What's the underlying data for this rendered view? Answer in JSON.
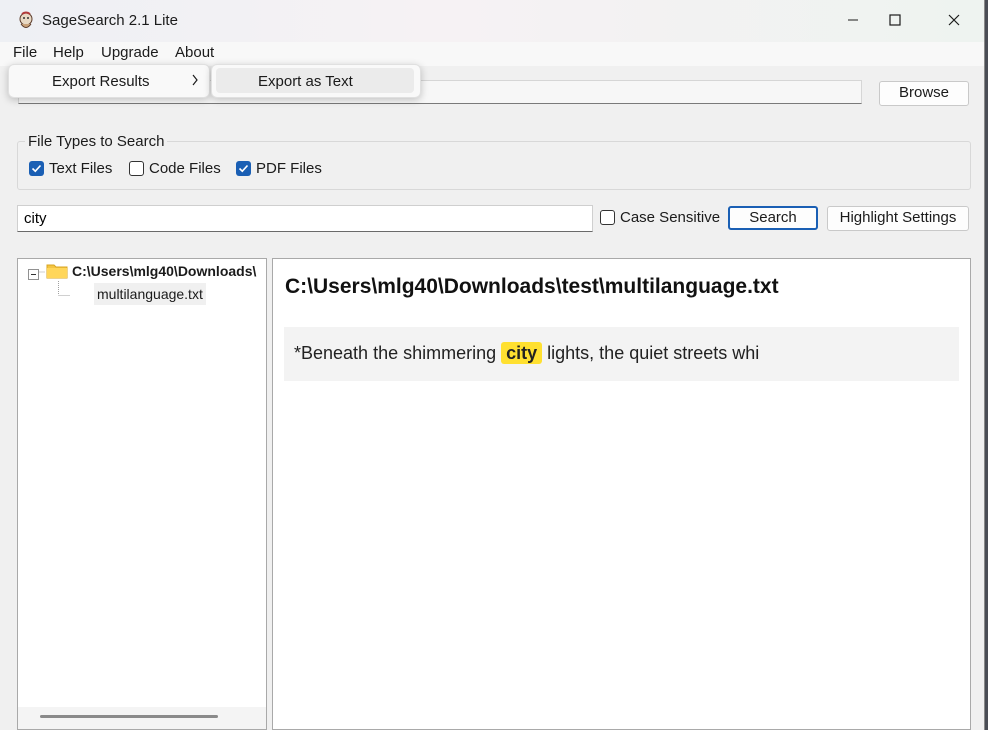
{
  "window": {
    "title": "SageSearch 2.1 Lite"
  },
  "menu": {
    "file": "File",
    "help": "Help",
    "upgrade": "Upgrade",
    "about": "About"
  },
  "dropdown": {
    "export_results": "Export Results",
    "export_as_text": "Export as Text"
  },
  "browse": {
    "label": "Browse"
  },
  "file_types": {
    "title": "File Types to Search",
    "options": [
      {
        "label": "Text Files",
        "checked": true
      },
      {
        "label": "Code Files",
        "checked": false
      },
      {
        "label": "PDF Files",
        "checked": true
      }
    ]
  },
  "search": {
    "query": "city",
    "case_sensitive_label": "Case Sensitive",
    "case_sensitive": false,
    "search_label": "Search",
    "highlight_label": "Highlight Settings"
  },
  "tree": {
    "root": "C:\\Users\\mlg40\\Downloads\\",
    "child": "multilanguage.txt"
  },
  "results": {
    "file_path": "C:\\Users\\mlg40\\Downloads\\test\\multilanguage.txt",
    "snippet_before": "*Beneath the shimmering ",
    "snippet_match": "city",
    "snippet_after": " lights, the quiet streets whi"
  },
  "colors": {
    "accent": "#1a5fb4",
    "highlight": "#ffe030"
  },
  "icons": [
    "app-icon",
    "minimize-icon",
    "maximize-icon",
    "close-icon",
    "chevron-right-icon",
    "checkbox-checked-icon",
    "checkbox-empty-icon",
    "collapse-icon",
    "folder-icon"
  ]
}
